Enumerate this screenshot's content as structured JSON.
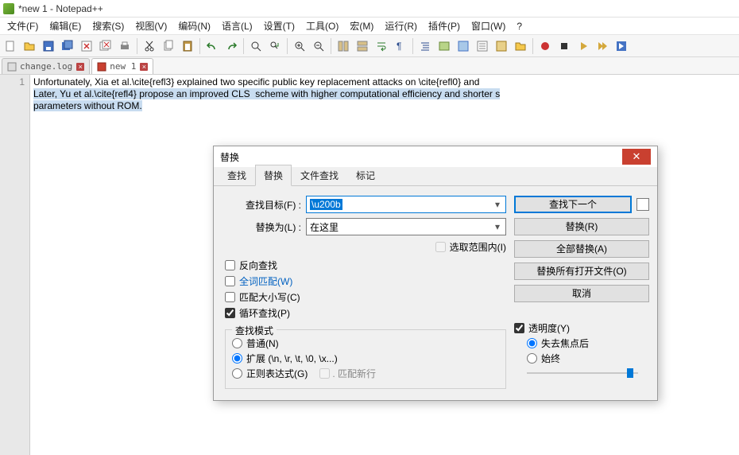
{
  "title": "*new 1 - Notepad++",
  "menus": [
    "文件(F)",
    "编辑(E)",
    "搜索(S)",
    "视图(V)",
    "编码(N)",
    "语言(L)",
    "设置(T)",
    "工具(O)",
    "宏(M)",
    "运行(R)",
    "插件(P)",
    "窗口(W)",
    "?"
  ],
  "tabs": [
    {
      "label": "change.log",
      "active": false
    },
    {
      "label": "new 1",
      "active": true
    }
  ],
  "gutter_line": "1",
  "editor_lines": [
    {
      "plain": "Unfortunately, Xia et al.\\cite{refl3} explained two specific public key replacement attacks on \\cite{refl0} and"
    },
    {
      "hl": "Later, Yu et al.\\cite{refl4} propose an improved CLS  scheme with higher computational efficiency and shorter s"
    },
    {
      "hl": "parameters without ROM."
    }
  ],
  "dialog": {
    "title": "替换",
    "tabs": [
      "查找",
      "替换",
      "文件查找",
      "标记"
    ],
    "active_tab": 1,
    "find_label": "查找目标(F) :",
    "find_value": "\\u200b",
    "replace_label": "替换为(L) :",
    "replace_value": "在这里",
    "in_selection": "选取范围内(I)",
    "btn_find_next": "查找下一个",
    "btn_replace": "替换(R)",
    "btn_replace_all": "全部替换(A)",
    "btn_replace_all_open": "替换所有打开文件(O)",
    "btn_cancel": "取消",
    "cb_backward": "反向查找",
    "cb_whole_word": "全词匹配(W)",
    "cb_match_case": "匹配大小写(C)",
    "cb_wrap": "循环查找(P)",
    "panel_search_mode": "查找模式",
    "rb_normal": "普通(N)",
    "rb_extended": "扩展 (\\n, \\r, \\t, \\0, \\x...)",
    "rb_regex": "正则表达式(G)",
    "cb_match_newline": ". 匹配新行",
    "cb_transparency": "透明度(Y)",
    "rb_lose_focus": "失去焦点后",
    "rb_always": "始终"
  }
}
